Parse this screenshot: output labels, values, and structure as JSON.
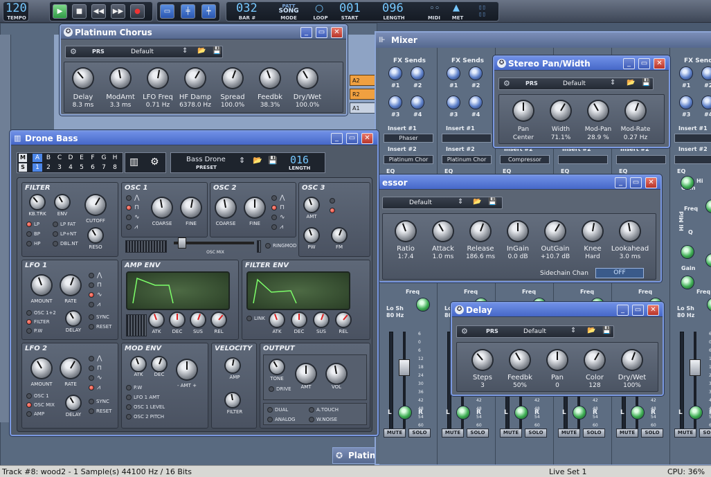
{
  "transport": {
    "tempo": "120",
    "tempo_label": "TEMPO",
    "bar": "032",
    "bar_label": "BAR #",
    "mode_top": "PATT",
    "mode_val": "SONG",
    "mode_label": "MODE",
    "loop_label": "LOOP",
    "start": "001",
    "start_label": "START",
    "length": "096",
    "length_label": "LENGTH",
    "midi_label": "MIDI",
    "met_label": "MET",
    "play_icon": "play-icon",
    "stop_icon": "stop-icon",
    "rewind_icon": "rewind-icon",
    "ffwd_icon": "fast-forward-icon",
    "record_icon": "record-icon"
  },
  "platinum_chorus": {
    "title": "Platinum Chorus",
    "preset_label": "PRS",
    "preset": "Default",
    "knobs": [
      {
        "label": "Delay",
        "value": "8.3 ms"
      },
      {
        "label": "ModAmt",
        "value": "3.3 ms"
      },
      {
        "label": "LFO Freq",
        "value": "0.71 Hz"
      },
      {
        "label": "HF Damp",
        "value": "6378.0 Hz"
      },
      {
        "label": "Spread",
        "value": "100.0%"
      },
      {
        "label": "Feedbk",
        "value": "38.3%"
      },
      {
        "label": "Dry/Wet",
        "value": "100.0%"
      }
    ]
  },
  "drone_bass": {
    "title": "Drone Bass",
    "ms": [
      "M",
      "S"
    ],
    "patterns_top": [
      "A",
      "B",
      "C",
      "D",
      "E",
      "F",
      "G",
      "H"
    ],
    "patterns_bottom": [
      "1",
      "2",
      "3",
      "4",
      "5",
      "6",
      "7",
      "8"
    ],
    "preset": "Bass Drone",
    "preset_label": "PRESET",
    "length": "016",
    "length_label": "LENGTH",
    "filter": {
      "title": "FILTER",
      "knobs": [
        "KB.TRK",
        "ENV",
        "CUTOFF",
        "RESO"
      ],
      "modes": [
        "LP",
        "LP FAT",
        "BP",
        "LP+NT",
        "HP",
        "DBL.NT"
      ]
    },
    "osc1": {
      "title": "OSC 1",
      "knobs": [
        "COARSE",
        "FINE"
      ]
    },
    "osc2": {
      "title": "OSC 2",
      "knobs": [
        "COARSE",
        "FINE"
      ]
    },
    "osc3": {
      "title": "OSC 3",
      "knobs": [
        "AMT",
        "PW",
        "FM"
      ]
    },
    "osc_mix": "OSC MIX",
    "ringmod": "RINGMOD",
    "lfo1": {
      "title": "LFO 1",
      "knobs": [
        "AMOUNT",
        "RATE",
        "DELAY"
      ],
      "targets": [
        "OSC 1+2",
        "FILTER",
        "P.W"
      ],
      "sync": "SYNC",
      "reset": "RESET"
    },
    "amp_env": {
      "title": "AMP ENV",
      "knobs": [
        "ATK",
        "DEC",
        "SUS",
        "REL"
      ]
    },
    "filter_env": {
      "title": "FILTER ENV",
      "knobs": [
        "ATK",
        "DEC",
        "SUS",
        "REL"
      ],
      "link": "LINK"
    },
    "lfo2": {
      "title": "LFO 2",
      "knobs": [
        "AMOUNT",
        "RATE",
        "DELAY"
      ],
      "targets": [
        "OSC 1",
        "OSC MIX",
        "AMP"
      ],
      "sync": "SYNC",
      "reset": "RESET"
    },
    "mod_env": {
      "title": "MOD ENV",
      "knobs": [
        "ATK",
        "DEC",
        "- AMT +"
      ],
      "targets": [
        "P.W",
        "LFO 1 AMT",
        "OSC 1 LEVEL",
        "OSC 2 PITCH"
      ]
    },
    "velocity": {
      "title": "VELOCITY",
      "knobs": [
        "AMP",
        "FILTER"
      ]
    },
    "output": {
      "title": "OUTPUT",
      "knobs": [
        "TONE",
        "AMT",
        "VOL"
      ],
      "drive": "DRIVE",
      "opts": [
        "DUAL",
        "A.TOUCH",
        "ANALOG",
        "W.NOISE"
      ]
    }
  },
  "mixer": {
    "title": "Mixer",
    "fx_sends": "FX Sends",
    "send_nums": [
      "#1",
      "#2",
      "#3",
      "#4"
    ],
    "insert1": "Insert #1",
    "insert2": "Insert #2",
    "strips": [
      {
        "ins1": "Phaser",
        "ins2": "Platinum Chor"
      },
      {
        "ins1": "",
        "ins2": "Platinum Chor"
      },
      {
        "ins1": "",
        "ins2": "Compressor"
      },
      {
        "ins1": "",
        "ins2": ""
      },
      {
        "ins1": "",
        "ins2": ""
      }
    ],
    "eq": "EQ",
    "freq": "Freq",
    "lo_sh": "Lo Sh",
    "lo_sh_val": "80 Hz",
    "hi_mid": "Hi Mid",
    "gain": "Gain",
    "q": "Q",
    "hi": "Hi",
    "mute": "MUTE",
    "solo": "SOLO",
    "fader_scale": [
      "6",
      "0",
      "6",
      "12",
      "18",
      "24",
      "30",
      "36",
      "42",
      "48",
      "54",
      "60"
    ]
  },
  "stereo_pan": {
    "title": "Stereo Pan/Width",
    "preset_label": "PRS",
    "preset": "Default",
    "knobs": [
      {
        "label": "Pan",
        "value": "Center"
      },
      {
        "label": "Width",
        "value": "71.1%"
      },
      {
        "label": "Mod-Pan",
        "value": "28.9 %"
      },
      {
        "label": "Mod-Rate",
        "value": "0.27 Hz"
      }
    ]
  },
  "compressor": {
    "title": "essor",
    "preset": "Default",
    "knobs": [
      {
        "label": "Ratio",
        "value": "1:7.4"
      },
      {
        "label": "Attack",
        "value": "1.0 ms"
      },
      {
        "label": "Release",
        "value": "186.6 ms"
      },
      {
        "label": "InGain",
        "value": "0.0 dB"
      },
      {
        "label": "OutGain",
        "value": "+10.7 dB"
      },
      {
        "label": "Knee",
        "value": "Hard"
      },
      {
        "label": "Lookahead",
        "value": "3.0 ms"
      }
    ],
    "sidechain": "Sidechain Chan",
    "sidechain_val": "OFF"
  },
  "delay": {
    "title": "Delay",
    "preset_label": "PRS",
    "preset": "Default",
    "knobs": [
      {
        "label": "Steps",
        "value": "3"
      },
      {
        "label": "Feedbk",
        "value": "50%"
      },
      {
        "label": "Pan",
        "value": "0"
      },
      {
        "label": "Color",
        "value": "128"
      },
      {
        "label": "Dry/Wet",
        "value": "100%"
      }
    ]
  },
  "background": {
    "platin_tab": "Platin",
    "song_rows": [
      "A2",
      "R2",
      "A1"
    ]
  },
  "status": {
    "left": "Track #8: wood2 - 1 Sample(s) 44100 Hz / 16 Bits",
    "mid": "Live Set 1",
    "right": "CPU: 36%"
  }
}
